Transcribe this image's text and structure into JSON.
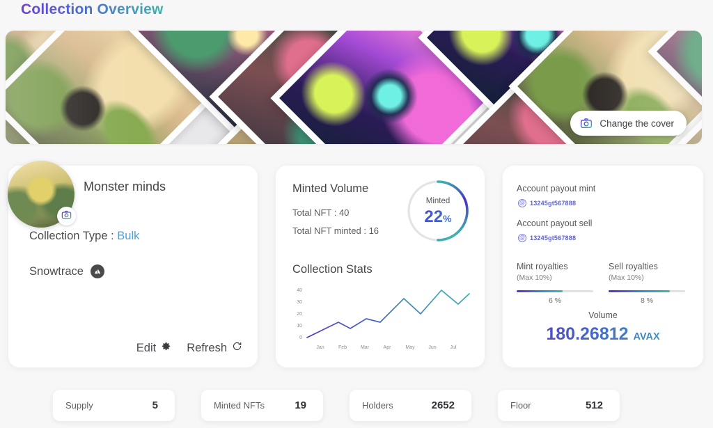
{
  "header": {
    "title": "Collection Overview"
  },
  "cover": {
    "change_button_label": "Change the cover",
    "camera_icon": "camera-icon"
  },
  "profile": {
    "name": "Monster minds",
    "avatar_camera_icon": "camera-icon",
    "collection_type_label": "Collection Type :",
    "collection_type_value": "Bulk",
    "chain": "Snowtrace",
    "chain_icon": "avalanche-icon",
    "edit_label": "Edit",
    "edit_icon": "gear-icon",
    "refresh_label": "Refresh",
    "refresh_icon": "refresh-icon"
  },
  "minted": {
    "title": "Minted Volume",
    "total_nft": "Total NFT : 40",
    "total_nft_minted": "Total NFT minted : 16",
    "donut_label": "Minted",
    "donut_value": "22",
    "donut_unit": "%",
    "stats_title": "Collection Stats"
  },
  "payout": {
    "mint_label": "Account payout mint",
    "mint_address": "13245gt567888",
    "sell_label": "Account payout sell",
    "sell_address": "13245gt567888",
    "mint_royalties": {
      "title": "Mint royalties",
      "max": "(Max 10%)",
      "percent": "6 %",
      "fill": 6
    },
    "sell_royalties": {
      "title": "Sell royalties",
      "max": "(Max 10%)",
      "percent": "8 %",
      "fill": 8
    },
    "volume_label": "Volume",
    "volume_value": "180.26812",
    "volume_unit": "AVAX"
  },
  "stats": [
    {
      "key": "Supply",
      "value": "5"
    },
    {
      "key": "Minted NFTs",
      "value": "19"
    },
    {
      "key": "Holders",
      "value": "2652"
    },
    {
      "key": "Floor",
      "value": "512"
    }
  ],
  "colors": {
    "accent_purple": "#5b2fc8",
    "accent_teal": "#3fb5ad",
    "accent_blue": "#4f9fd6",
    "background": "#f7f7f8",
    "card": "#ffffff"
  },
  "chart_data": {
    "type": "line",
    "title": "Collection Stats",
    "categories": [
      "Jan",
      "Feb",
      "Mar",
      "Apr",
      "May",
      "Jun",
      "Jul"
    ],
    "x": [
      0,
      0.5,
      1,
      1.25,
      1.5,
      2,
      2.5,
      3,
      3.5,
      4,
      4.5,
      5,
      5.5,
      6
    ],
    "values": [
      0,
      13,
      8,
      16,
      13,
      33,
      20,
      43,
      29,
      39
    ],
    "series": [
      {
        "name": "Minted",
        "values": [
          0,
          13,
          8,
          16,
          13,
          33,
          20,
          43,
          29,
          39
        ]
      }
    ],
    "ytick_labels": [
      "0",
      "10",
      "20",
      "30",
      "40"
    ],
    "yticks": [
      0,
      10,
      20,
      30,
      40
    ],
    "ylim": [
      0,
      45
    ],
    "xlabel": "",
    "ylabel": "",
    "grid": false,
    "legend": "none"
  }
}
